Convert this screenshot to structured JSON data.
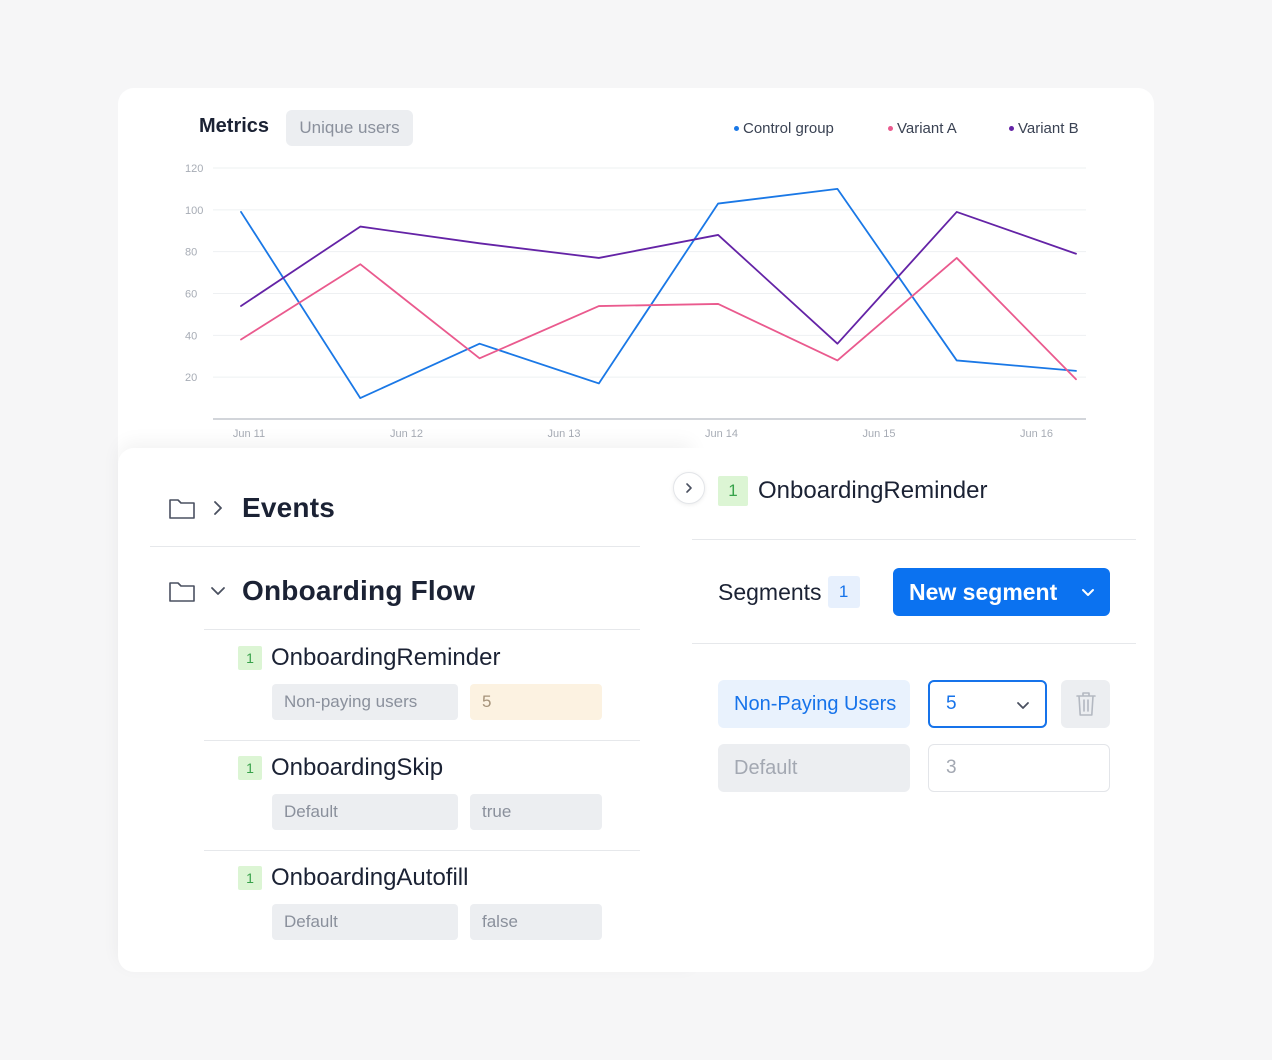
{
  "metrics": {
    "title": "Metrics",
    "metric_pill": "Unique users"
  },
  "chart_data": {
    "type": "line",
    "title": "Metrics",
    "x": [
      "Jun 11",
      "",
      "Jun 12",
      "",
      "Jun 13",
      "",
      "Jun 14",
      "",
      "Jun 15",
      "",
      "Jun 16"
    ],
    "xlabels": [
      "Jun 11",
      "Jun 12",
      "Jun 13",
      "Jun 14",
      "Jun 15",
      "Jun 16"
    ],
    "ylim": [
      0,
      120
    ],
    "yticks": [
      20,
      40,
      60,
      80,
      100,
      120
    ],
    "grid": true,
    "legend_position": "top-right",
    "series": [
      {
        "name": "Control group",
        "color": "#1a78e6",
        "x": [
          0,
          1,
          2,
          3,
          4,
          5,
          6,
          7
        ],
        "values": [
          99,
          10,
          36,
          17,
          103,
          110,
          28,
          23
        ]
      },
      {
        "name": "Variant A",
        "color": "#ea5a8e",
        "x": [
          0,
          1,
          2,
          3,
          4,
          5,
          6,
          7
        ],
        "values": [
          38,
          74,
          29,
          54,
          55,
          28,
          77,
          19
        ]
      },
      {
        "name": "Variant B",
        "color": "#6423a6",
        "x": [
          0,
          1,
          2,
          3,
          4,
          5,
          6,
          7
        ],
        "values": [
          54,
          92,
          84,
          77,
          88,
          36,
          99,
          79
        ]
      }
    ]
  },
  "tree": {
    "groups": [
      {
        "label": "Events",
        "expanded": false
      },
      {
        "label": "Onboarding Flow",
        "expanded": true
      }
    ],
    "items": [
      {
        "badge": "1",
        "name": "OnboardingReminder",
        "segment": "Non-paying users",
        "value": "5"
      },
      {
        "badge": "1",
        "name": "OnboardingSkip",
        "segment": "Default",
        "value": "true"
      },
      {
        "badge": "1",
        "name": "OnboardingAutofill",
        "segment": "Default",
        "value": "false"
      }
    ]
  },
  "detail": {
    "badge": "1",
    "title": "OnboardingReminder",
    "segments_label": "Segments",
    "segments_count": "1",
    "new_segment_label": "New segment",
    "rows": [
      {
        "segment": "Non-Paying Users",
        "value": "5"
      },
      {
        "segment": "Default",
        "value": "3"
      }
    ]
  },
  "colors": {
    "accent": "#0b72f0",
    "badge_green_bg": "#dcf5d4",
    "badge_green_fg": "#37a24a"
  },
  "icons": [
    "folder-icon",
    "chevron-right-icon",
    "chevron-down-icon",
    "trash-icon"
  ]
}
